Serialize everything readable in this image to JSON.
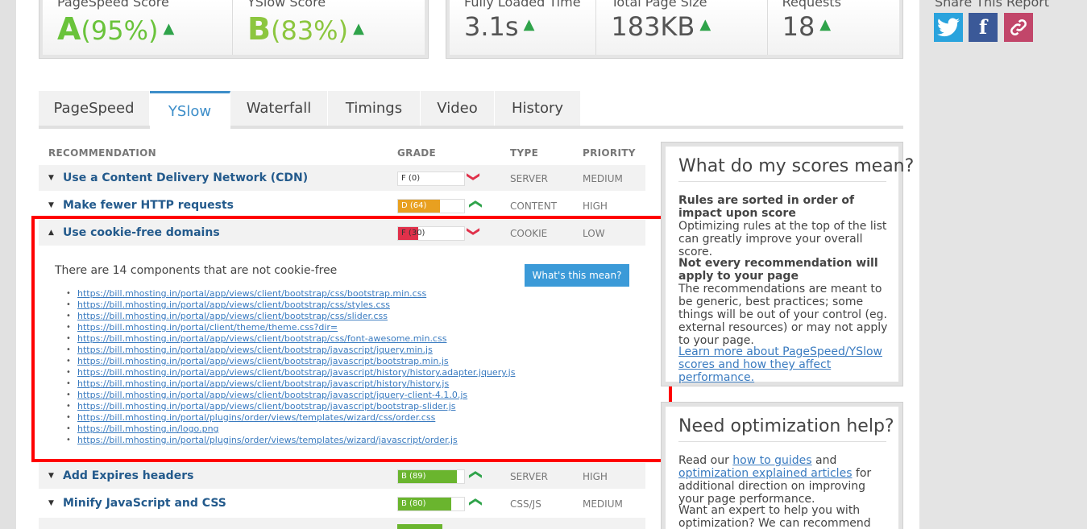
{
  "scores": {
    "pagespeed": {
      "label": "PageSpeed Score",
      "grade": "A",
      "value": "(95%)"
    },
    "yslow": {
      "label": "YSlow Score",
      "grade": "B",
      "value": "(83%)"
    }
  },
  "metrics": [
    {
      "label": "Fully Loaded Time",
      "value": "3.1s"
    },
    {
      "label": "Total Page Size",
      "value": "183KB"
    },
    {
      "label": "Requests",
      "value": "18"
    }
  ],
  "share": {
    "title": "Share This Report"
  },
  "tabs": [
    "PageSpeed",
    "YSlow",
    "Waterfall",
    "Timings",
    "Video",
    "History"
  ],
  "active_tab": "YSlow",
  "table": {
    "headers": {
      "recommendation": "RECOMMENDATION",
      "grade": "GRADE",
      "type": "TYPE",
      "priority": "PRIORITY"
    },
    "rows": [
      {
        "title": "Use a Content Delivery Network (CDN)",
        "grade": "F (0)",
        "grade_pct": 0,
        "color": "#e0304a",
        "trend": "down",
        "type": "SERVER",
        "priority": "MEDIUM"
      },
      {
        "title": "Make fewer HTTP requests",
        "grade": "D (64)",
        "grade_pct": 64,
        "color": "#e8a020",
        "trend": "up",
        "type": "CONTENT",
        "priority": "HIGH"
      },
      {
        "title": "Use cookie-free domains",
        "grade": "F (30)",
        "grade_pct": 30,
        "color": "#e0304a",
        "trend": "down",
        "type": "COOKIE",
        "priority": "LOW"
      },
      {
        "title": "Add Expires headers",
        "grade": "B (89)",
        "grade_pct": 89,
        "color": "#6ab52e",
        "trend": "up",
        "type": "SERVER",
        "priority": "HIGH"
      },
      {
        "title": "Minify JavaScript and CSS",
        "grade": "B (80)",
        "grade_pct": 80,
        "color": "#6ab52e",
        "trend": "up",
        "type": "CSS/JS",
        "priority": "MEDIUM"
      }
    ]
  },
  "detail": {
    "text": "There are 14 components that are not cookie-free",
    "button": "What's this mean?",
    "urls": [
      "https://bill.mhosting.in/portal/app/views/client/bootstrap/css/bootstrap.min.css",
      "https://bill.mhosting.in/portal/app/views/client/bootstrap/css/styles.css",
      "https://bill.mhosting.in/portal/app/views/client/bootstrap/css/slider.css",
      "https://bill.mhosting.in/portal/client/theme/theme.css?dir=",
      "https://bill.mhosting.in/portal/app/views/client/bootstrap/css/font-awesome.min.css",
      "https://bill.mhosting.in/portal/app/views/client/bootstrap/javascript/jquery.min.js",
      "https://bill.mhosting.in/portal/app/views/client/bootstrap/javascript/bootstrap.min.js",
      "https://bill.mhosting.in/portal/app/views/client/bootstrap/javascript/history/history.adapter.jquery.js",
      "https://bill.mhosting.in/portal/app/views/client/bootstrap/javascript/history/history.js",
      "https://bill.mhosting.in/portal/app/views/client/bootstrap/javascript/jquery-client-4.1.0.js",
      "https://bill.mhosting.in/portal/app/views/client/bootstrap/javascript/bootstrap-slider.js",
      "https://bill.mhosting.in/portal/plugins/order/views/templates/wizard/css/order.css",
      "https://bill.mhosting.in/logo.png",
      "https://bill.mhosting.in/portal/plugins/order/views/templates/wizard/javascript/order.js"
    ]
  },
  "panel1": {
    "title": "What do my scores mean?",
    "h1": "Rules are sorted in order of impact upon score",
    "p1": "Optimizing rules at the top of the list can greatly improve your overall score.",
    "h2": "Not every recommendation will apply to your page",
    "p2": "The recommendations are meant to be generic, best practices; some things will be out of your control (eg. external resources) or may not apply to your page.",
    "link": "Learn more about PageSpeed/YSlow scores and how they affect performance."
  },
  "panel2": {
    "title": "Need optimization help?",
    "p1_a": "Read our ",
    "link1": "how to guides",
    "p1_b": " and ",
    "link2": "optimization explained articles",
    "p1_c": " for additional direction on improving your page performance.",
    "p2": "Want an expert to help you with optimization? We can recommend"
  },
  "icons": {
    "twitter": "twitter-icon",
    "facebook": "facebook-icon",
    "link": "link-icon"
  }
}
